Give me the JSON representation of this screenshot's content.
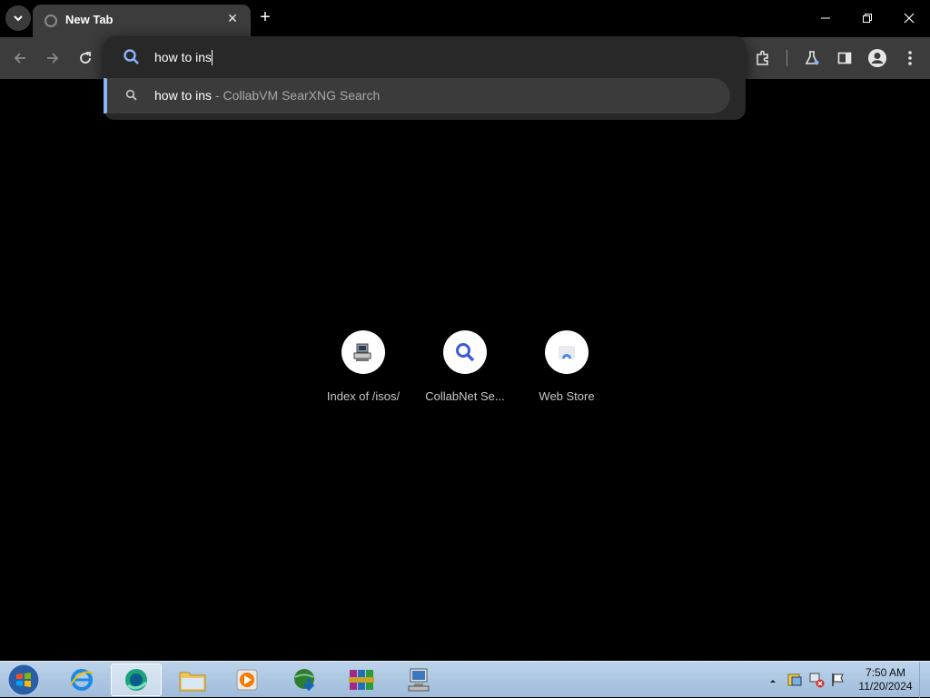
{
  "tab": {
    "title": "New Tab",
    "close": "✕"
  },
  "new_tab": "+",
  "omnibox": {
    "value": "how to ins"
  },
  "suggestion": {
    "query": "how to ins",
    "desc": " - CollabVM SearXNG Search"
  },
  "shortcuts": [
    {
      "label": "Index of /isos/",
      "icon": "computer-icon"
    },
    {
      "label": "CollabNet Se...",
      "icon": "search-icon"
    },
    {
      "label": "Web Store",
      "icon": "webstore-icon"
    }
  ],
  "clock": {
    "time": "7:50 AM",
    "date": "11/20/2024"
  },
  "colors": {
    "accent": "#8ab4f8",
    "toolbar": "#3c3c3c",
    "background": "#000000"
  }
}
